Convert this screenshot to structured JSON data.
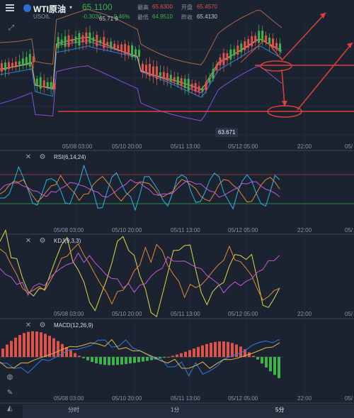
{
  "header": {
    "title": "WTI原油",
    "symbol": "USOIL",
    "price": "65.1100",
    "change": "-0.3030",
    "change_pct": "-0.46%",
    "high_label": "最高",
    "high": "65.6300",
    "open_label": "开盘",
    "open": "65.4570",
    "low_label": "最低",
    "low": "64.9510",
    "prev_label": "昨收",
    "prev": "65.4130"
  },
  "main": {
    "peak_label": "65.71 9",
    "low_label": "63.671",
    "time_ticks": [
      "05/08 03:00",
      "05/10 20:00",
      "05/11 13:00",
      "05/12 05:00",
      "22:00",
      "05/"
    ]
  },
  "panels": {
    "rsi": {
      "title": "RSI(6,14,24)"
    },
    "kdj": {
      "title": "KDJ(9,3,3)"
    },
    "macd": {
      "title": "MACD(12,26,9)"
    }
  },
  "timeframes": [
    "分时",
    "1分",
    "5分"
  ],
  "colors": {
    "up": "#e0534a",
    "down": "#3fb24a",
    "bg": "#1b2230",
    "accent": "#2bb6e0",
    "annotation": "#e0403a"
  },
  "chart_data": [
    {
      "type": "line",
      "title": "WTI原油 USOIL",
      "ylabel": "",
      "note_max": "65.71 9",
      "note_min": "63.671"
    },
    {
      "type": "line",
      "title": "RSI(6,14,24)"
    },
    {
      "type": "line",
      "title": "KDJ(9,3,3)"
    },
    {
      "type": "bar",
      "title": "MACD(12,26,9)"
    }
  ]
}
